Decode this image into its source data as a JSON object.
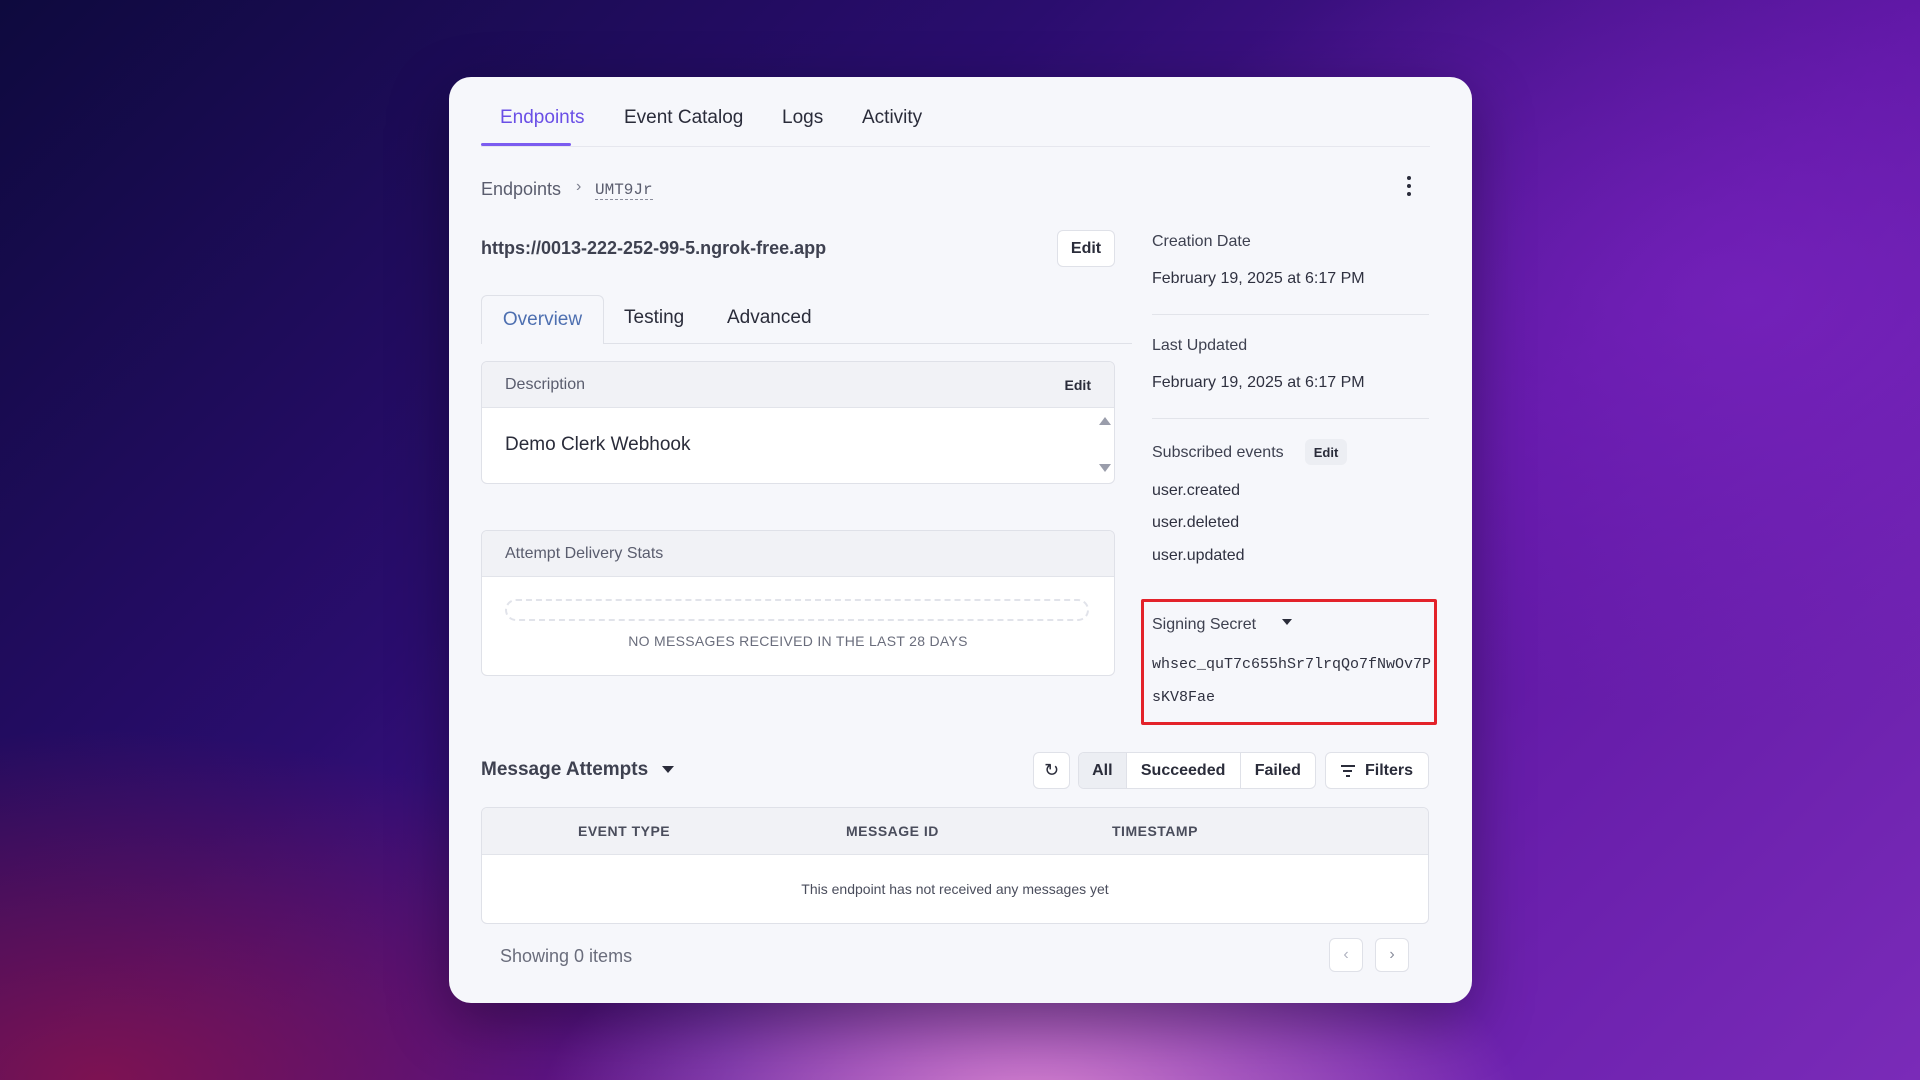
{
  "top_tabs": [
    "Endpoints",
    "Event Catalog",
    "Logs",
    "Activity"
  ],
  "breadcrumb": {
    "root": "Endpoints",
    "separator": "›",
    "id": "UMT9Jr"
  },
  "endpoint": {
    "url": "https://0013-222-252-99-5.ngrok-free.app",
    "edit_label": "Edit"
  },
  "sub_tabs": [
    "Overview",
    "Testing",
    "Advanced"
  ],
  "description": {
    "title": "Description",
    "edit_label": "Edit",
    "value": "Demo Clerk Webhook"
  },
  "stats": {
    "title": "Attempt Delivery Stats",
    "empty_text": "NO MESSAGES RECEIVED IN THE LAST 28 DAYS"
  },
  "details": {
    "creation_label": "Creation Date",
    "creation_value": "February 19, 2025 at 6:17 PM",
    "updated_label": "Last Updated",
    "updated_value": "February 19, 2025 at 6:17 PM",
    "events_label": "Subscribed events",
    "events_edit": "Edit",
    "events": [
      "user.created",
      "user.deleted",
      "user.updated"
    ],
    "secret_label": "Signing Secret",
    "secret_line1": "whsec_quT7c655hSr7lrqQo7fNwOv7P",
    "secret_line2": "sKV8Fae"
  },
  "messages": {
    "title": "Message Attempts",
    "filters": [
      "All",
      "Succeeded",
      "Failed"
    ],
    "filters_button": "Filters",
    "columns": [
      "EVENT TYPE",
      "MESSAGE ID",
      "TIMESTAMP"
    ],
    "empty_text": "This endpoint has not received any messages yet",
    "showing": "Showing 0 items"
  },
  "colors": {
    "accent": "#7b5cf0",
    "highlight_border": "#e3222a"
  }
}
